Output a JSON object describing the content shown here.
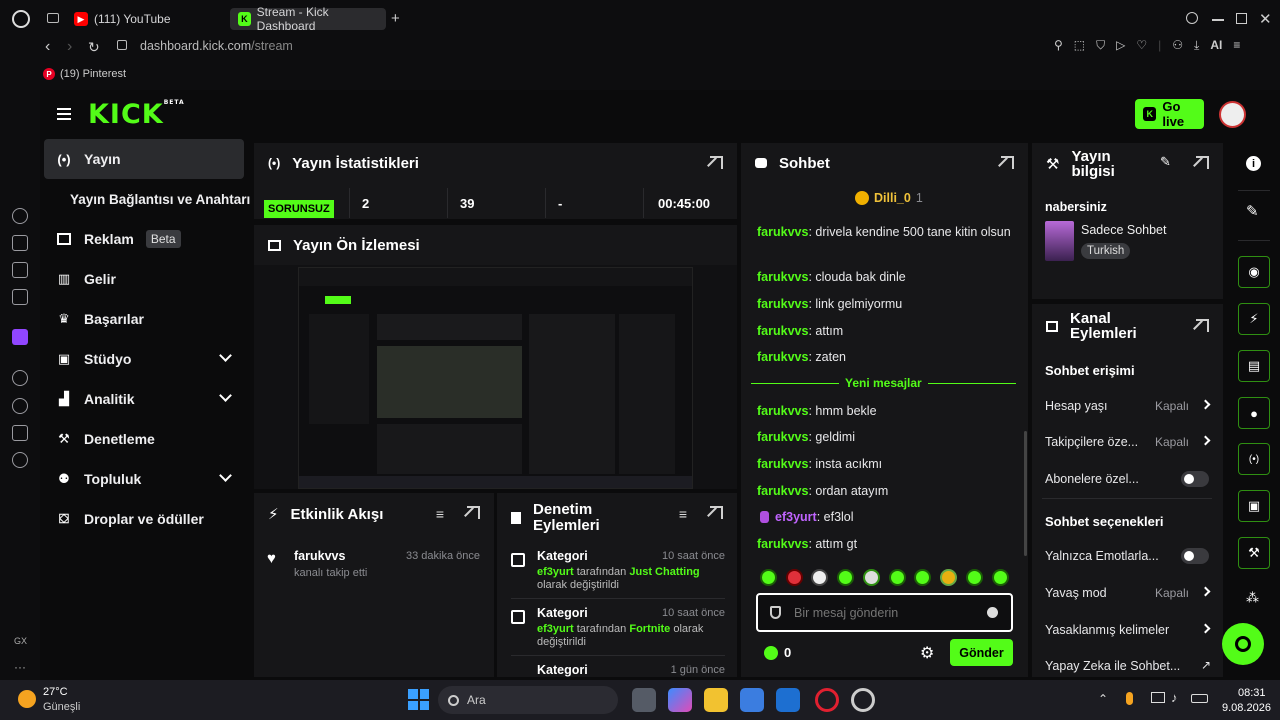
{
  "browser": {
    "tabs": [
      {
        "label": "(111) YouTube",
        "active": false
      },
      {
        "label": "Stream - Kick Dashboard",
        "active": true
      }
    ],
    "url_host": "dashboard.kick.com",
    "url_path": "/stream",
    "bookmark": "(19) Pinterest",
    "ai_label": "AI"
  },
  "colors": {
    "accent": "#53fc18",
    "panel": "#161618",
    "bg": "#0b0b0c"
  },
  "logo": "KICK",
  "logo_sup": "BETA",
  "header": {
    "go_live": "Go live"
  },
  "sidebar": {
    "items": [
      {
        "label": "Yayın",
        "icon": "broadcast-icon"
      },
      {
        "label": "Yayın Bağlantısı ve Anahtarı"
      },
      {
        "label": "Reklam",
        "badge": "Beta",
        "icon": "ad-icon"
      },
      {
        "label": "Gelir",
        "icon": "chart-icon"
      },
      {
        "label": "Başarılar",
        "icon": "trophy-icon"
      },
      {
        "label": "Stüdyo",
        "icon": "studio-icon"
      },
      {
        "label": "Analitik",
        "icon": "analytics-icon"
      },
      {
        "label": "Denetleme",
        "icon": "wrench-icon"
      },
      {
        "label": "Topluluk",
        "icon": "community-icon"
      },
      {
        "label": "Droplar ve ödüller",
        "icon": "drops-icon"
      }
    ],
    "rail_bottom": "GX"
  },
  "stats": {
    "title": "Yayın İstatistikleri",
    "status": "SORUNSUZ",
    "values": [
      "2",
      "39",
      "-",
      "00:45:00"
    ]
  },
  "preview": {
    "title": "Yayın Ön İzlemesi"
  },
  "activity": {
    "title": "Etkinlik Akışı",
    "items": [
      {
        "user": "farukvvs",
        "time": "33 dakika önce",
        "text": "kanalı takip etti"
      }
    ]
  },
  "moderation": {
    "title": "Denetim Eylemleri",
    "items": [
      {
        "label": "Kategori",
        "time": "10 saat önce",
        "user": "ef3yurt",
        "mid": "tarafından",
        "game": "Just Chatting",
        "tail": "olarak değiştirildi"
      },
      {
        "label": "Kategori",
        "time": "10 saat önce",
        "user": "ef3yurt",
        "mid": "tarafından",
        "game": "Fortnite",
        "tail": "olarak değiştirildi"
      },
      {
        "label": "Kategori",
        "time": "1 gün önce"
      }
    ]
  },
  "chat": {
    "title": "Sohbet",
    "pinned_user": "Dilli_0",
    "pinned_count": "1",
    "messages_before": [
      {
        "user": "farukvvs",
        "text": "drivela kendine 500 tane kitin olsun"
      },
      {
        "user": "farukvvs",
        "text": "clouda bak dinle"
      },
      {
        "user": "farukvvs",
        "text": "link gelmiyormu"
      },
      {
        "user": "farukvvs",
        "text": "attım"
      },
      {
        "user": "farukvvs",
        "text": "zaten"
      }
    ],
    "new_label": "Yeni mesajlar",
    "messages_after": [
      {
        "user": "farukvvs",
        "text": "hmm bekle"
      },
      {
        "user": "farukvvs",
        "text": "geldimi"
      },
      {
        "user": "farukvvs",
        "text": "insta acıkmı"
      },
      {
        "user": "farukvvs",
        "text": "ordan atayım"
      },
      {
        "user": "ef3yurt",
        "text": "ef3lol"
      },
      {
        "user": "farukvvs",
        "text": "attım gt"
      }
    ],
    "placeholder": "Bir mesaj gönderin",
    "balance": "0",
    "send": "Gönder"
  },
  "stream_info": {
    "title": "Yayın bilgisi",
    "stream_title": "nabersiniz",
    "category": "Sadece Sohbet",
    "language": "Turkish"
  },
  "channel_actions": {
    "title": "Kanal Eylemleri",
    "chat_access": "Sohbet erişimi",
    "rows_access": [
      {
        "label": "Hesap yaşı",
        "value": "Kapalı",
        "kind": "arrow"
      },
      {
        "label": "Takipçilere öze...",
        "value": "Kapalı",
        "kind": "arrow"
      },
      {
        "label": "Abonelere özel...",
        "kind": "toggle"
      }
    ],
    "chat_options": "Sohbet seçenekleri",
    "rows_options": [
      {
        "label": "Yalnızca Emotlarla...",
        "kind": "toggle"
      },
      {
        "label": "Yavaş mod",
        "value": "Kapalı",
        "kind": "arrow"
      },
      {
        "label": "Yasaklanmış kelimeler",
        "kind": "arrow"
      },
      {
        "label": "Yapay Zeka ile Sohbet...",
        "kind": "external"
      }
    ]
  },
  "taskbar": {
    "temp": "27°C",
    "weather": "Güneşli",
    "search": "Ara",
    "time": "08:31",
    "date": "9.08.2026"
  }
}
